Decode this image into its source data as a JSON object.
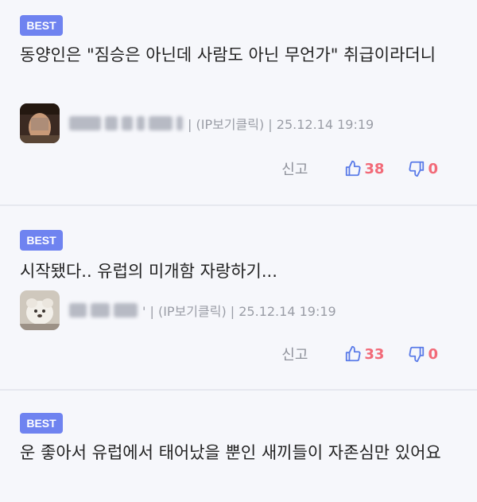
{
  "comments": [
    {
      "badge": "BEST",
      "text": "동양인은 \"짐승은 아닌데 사람도 아닌 무언가\" 취급이라더니",
      "info": "| (IP보기클릭) | 25.12.14 19:19",
      "report_label": "신고",
      "likes": "38",
      "dislikes": "0"
    },
    {
      "badge": "BEST",
      "text": "시작됐다.. 유럽의 미개함 자랑하기...",
      "info": "' | (IP보기클릭) | 25.12.14 19:19",
      "report_label": "신고",
      "likes": "33",
      "dislikes": "0"
    },
    {
      "badge": "BEST",
      "text": "운 좋아서 유럽에서 태어났을 뿐인 새끼들이 자존심만 있어요"
    }
  ],
  "colors": {
    "badge": "#6f83f0",
    "like_icon": "#5a7be8",
    "count": "#f26a78",
    "background": "#f6f7fb"
  }
}
